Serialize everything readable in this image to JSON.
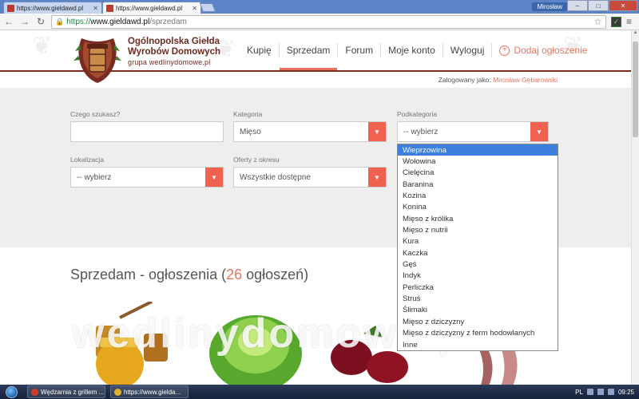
{
  "browser": {
    "tabs": [
      {
        "label": "https://www.gieldawd.pl",
        "active": false
      },
      {
        "label": "https://www.gieldawd.pl",
        "active": true
      }
    ],
    "user": "Mirosław",
    "window_buttons": [
      "–",
      "□",
      "✕"
    ],
    "url": {
      "scheme": "https://",
      "host": "www.gieldawd.pl",
      "path": "/sprzedam"
    }
  },
  "site": {
    "brand_line1": "Ogólnopolska Giełda",
    "brand_line2": "Wyrobów Domowych",
    "brand_sub": "grupa wedlinydomowe.pl",
    "nav": [
      {
        "label": "Kupię",
        "active": false
      },
      {
        "label": "Sprzedam",
        "active": true
      },
      {
        "label": "Forum",
        "active": false
      },
      {
        "label": "Moje konto",
        "active": false
      },
      {
        "label": "Wyloguj",
        "active": false
      }
    ],
    "add_listing": "Dodaj ogłoszenie",
    "logged_label": "Zalogowany jako:",
    "logged_user": "Mirosław Gębarowski",
    "accent": "#e9735f",
    "brand_color": "#6e2a1f"
  },
  "search": {
    "query_label": "Czego szukasz?",
    "query_value": "",
    "category_label": "Kategoria",
    "category_value": "Mięso",
    "subcategory_label": "Podkategoria",
    "subcategory_value": "-- wybierz",
    "location_label": "Lokalizacja",
    "location_value": "-- wybierz",
    "period_label": "Oferty z okresu",
    "period_value": "Wszystkie dostępne"
  },
  "subcategory_options": [
    "Wieprzowina",
    "Wołowina",
    "Cielęcina",
    "Baranina",
    "Kozina",
    "Konina",
    "Mięso z królika",
    "Mięso z nutrii",
    "Kura",
    "Kaczka",
    "Gęś",
    "Indyk",
    "Perliczka",
    "Struś",
    "Ślimaki",
    "Mięso z dziczyzny",
    "Mięso z dziczyzny z ferm hodowlanych",
    "Inne"
  ],
  "listing": {
    "heading_prefix": "Sprzedam - ogłoszenia (",
    "count": "26",
    "heading_suffix": " ogłoszeń)",
    "watermark": "wedlinydomowe.pl"
  },
  "taskbar": {
    "tasks": [
      {
        "label": "Wędzarnia z grillem ...",
        "icon_color": "#d03a2a"
      },
      {
        "label": "https://www.gielda...",
        "icon_color": "#e0b02a"
      }
    ],
    "lang": "PL",
    "time": "09:25"
  }
}
